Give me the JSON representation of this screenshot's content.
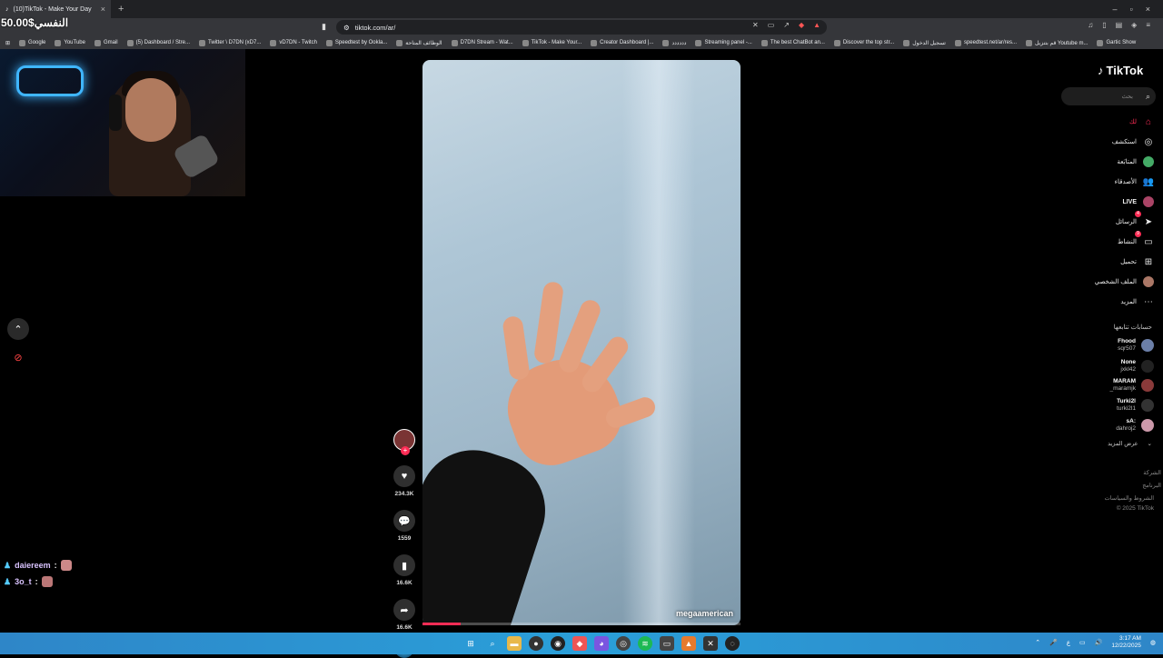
{
  "browser": {
    "tab_title": "(10)TikTok - Make Your Day",
    "tab_close": "×",
    "new_tab": "+",
    "url": "tiktok.com/ar/",
    "window_controls": [
      "–",
      "▫",
      "×"
    ]
  },
  "bookmarks": [
    "Google",
    "YouTube",
    "Gmail",
    "(5) Dashboard / Stre...",
    "Twitter \\ D7DN (xD7...",
    "vD7DN - Twitch",
    "Speedtest by Ookla...",
    "الوظائف المتاحة",
    "D7DN Stream - Wat...",
    "TikTok - Make Your...",
    "Creator Dashboard |...",
    "دددددد",
    "Streaming panel -...",
    "The best ChatBot an...",
    "Discover the top str...",
    "تسجيل الدخول",
    "speedtest.net/ar/res...",
    "قم بتنزيل Youtube m...",
    "Gartic Show"
  ],
  "stream": {
    "donation_text": "50.00$النفسي",
    "chat": [
      {
        "name": "daiereem",
        "sep": ":"
      },
      {
        "name": "3o_t",
        "sep": ":"
      }
    ]
  },
  "video": {
    "handle": "megaamerican",
    "progress": 0.12,
    "likes": "234.3K",
    "comments": "1559",
    "saves": "16.6K",
    "shares": "16.6K"
  },
  "tiktok": {
    "logo": "TikTok",
    "search_placeholder": "بحث",
    "nav": [
      {
        "label": "لك",
        "icon": "home-icon",
        "glyph": "⌂",
        "active": true
      },
      {
        "label": "استكشف",
        "icon": "compass-icon",
        "glyph": "◎"
      },
      {
        "label": "المتابَعة",
        "icon": "following-icon",
        "glyph": "●"
      },
      {
        "label": "الأصدقاء",
        "icon": "friends-icon",
        "glyph": "👥"
      },
      {
        "label": "LIVE",
        "icon": "live-icon",
        "glyph": "●"
      },
      {
        "label": "الرسائل",
        "icon": "messages-icon",
        "glyph": "➤",
        "badge": "4"
      },
      {
        "label": "النشاط",
        "icon": "activity-icon",
        "glyph": "▭",
        "badge": "9"
      },
      {
        "label": "تحميل",
        "icon": "upload-icon",
        "glyph": "⊞"
      },
      {
        "label": "الملف الشخصي",
        "icon": "profile-icon",
        "glyph": "●"
      },
      {
        "label": "المزيد",
        "icon": "more-icon",
        "glyph": "⋯"
      }
    ],
    "following_title": "حسابات تتابعها",
    "accounts": [
      {
        "name": "Fhood",
        "sub": "sqr507"
      },
      {
        "name": "None",
        "sub": "jxkl42"
      },
      {
        "name": "MARAM",
        "sub": "_maramjk"
      },
      {
        "name": "Turki2l",
        "sub": "turki2l1"
      },
      {
        "name": "sA:",
        "sub": "dahroj2"
      }
    ],
    "see_more": "عرض المزيد",
    "footer": [
      "الشركة",
      "البرنامج",
      "الشروط والسياسات",
      "© 2025 TikTok"
    ]
  },
  "taskbar": {
    "lang": "ع",
    "time": "3:17 AM",
    "date": "12/22/2025"
  },
  "colors": {
    "accent": "#fe2c55",
    "taskbar": "#2a9fd9"
  }
}
